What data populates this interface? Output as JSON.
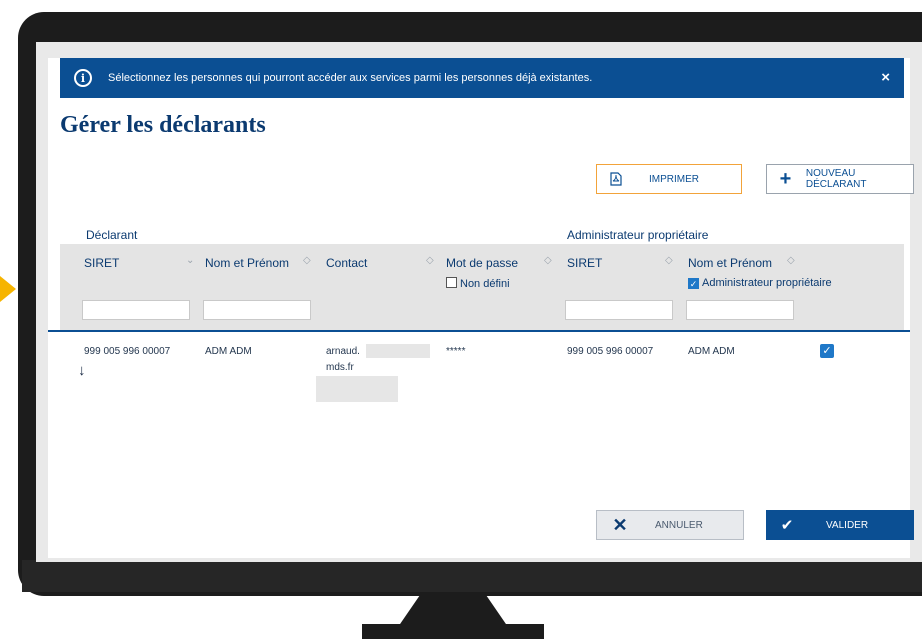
{
  "banner": {
    "message": "Sélectionnez les personnes qui pourront accéder aux services parmi les personnes déjà existantes.",
    "close_glyph": "×"
  },
  "page": {
    "title": "Gérer les déclarants"
  },
  "toolbar": {
    "print_label": "IMPRIMER",
    "new_label": "NOUVEAU DÉCLARANT"
  },
  "table": {
    "group_declarant": "Déclarant",
    "group_admin": "Administrateur propriétaire",
    "columns": {
      "siret": "SIRET",
      "nom_prenom": "Nom et Prénom",
      "contact": "Contact",
      "mot_de_passe": "Mot de passe",
      "admin_siret": "SIRET",
      "admin_nom_prenom": "Nom et Prénom"
    },
    "filters": {
      "non_defini": "Non défini",
      "admin_proprietaire": "Administrateur propriétaire"
    },
    "rows": [
      {
        "siret": "999 005 996 00007",
        "nom_prenom": "ADM ADM",
        "contact_line1": "arnaud.",
        "contact_line2": "mds.fr",
        "mot_de_passe": "*****",
        "admin_siret": "999 005 996 00007",
        "admin_nom_prenom": "ADM ADM",
        "admin_checked": true
      }
    ]
  },
  "footer": {
    "cancel_label": "ANNULER",
    "validate_label": "VALIDER"
  },
  "colors": {
    "brand_blue": "#0b4f93",
    "accent_orange": "#f2a33a",
    "pointer_yellow": "#f6b400"
  }
}
